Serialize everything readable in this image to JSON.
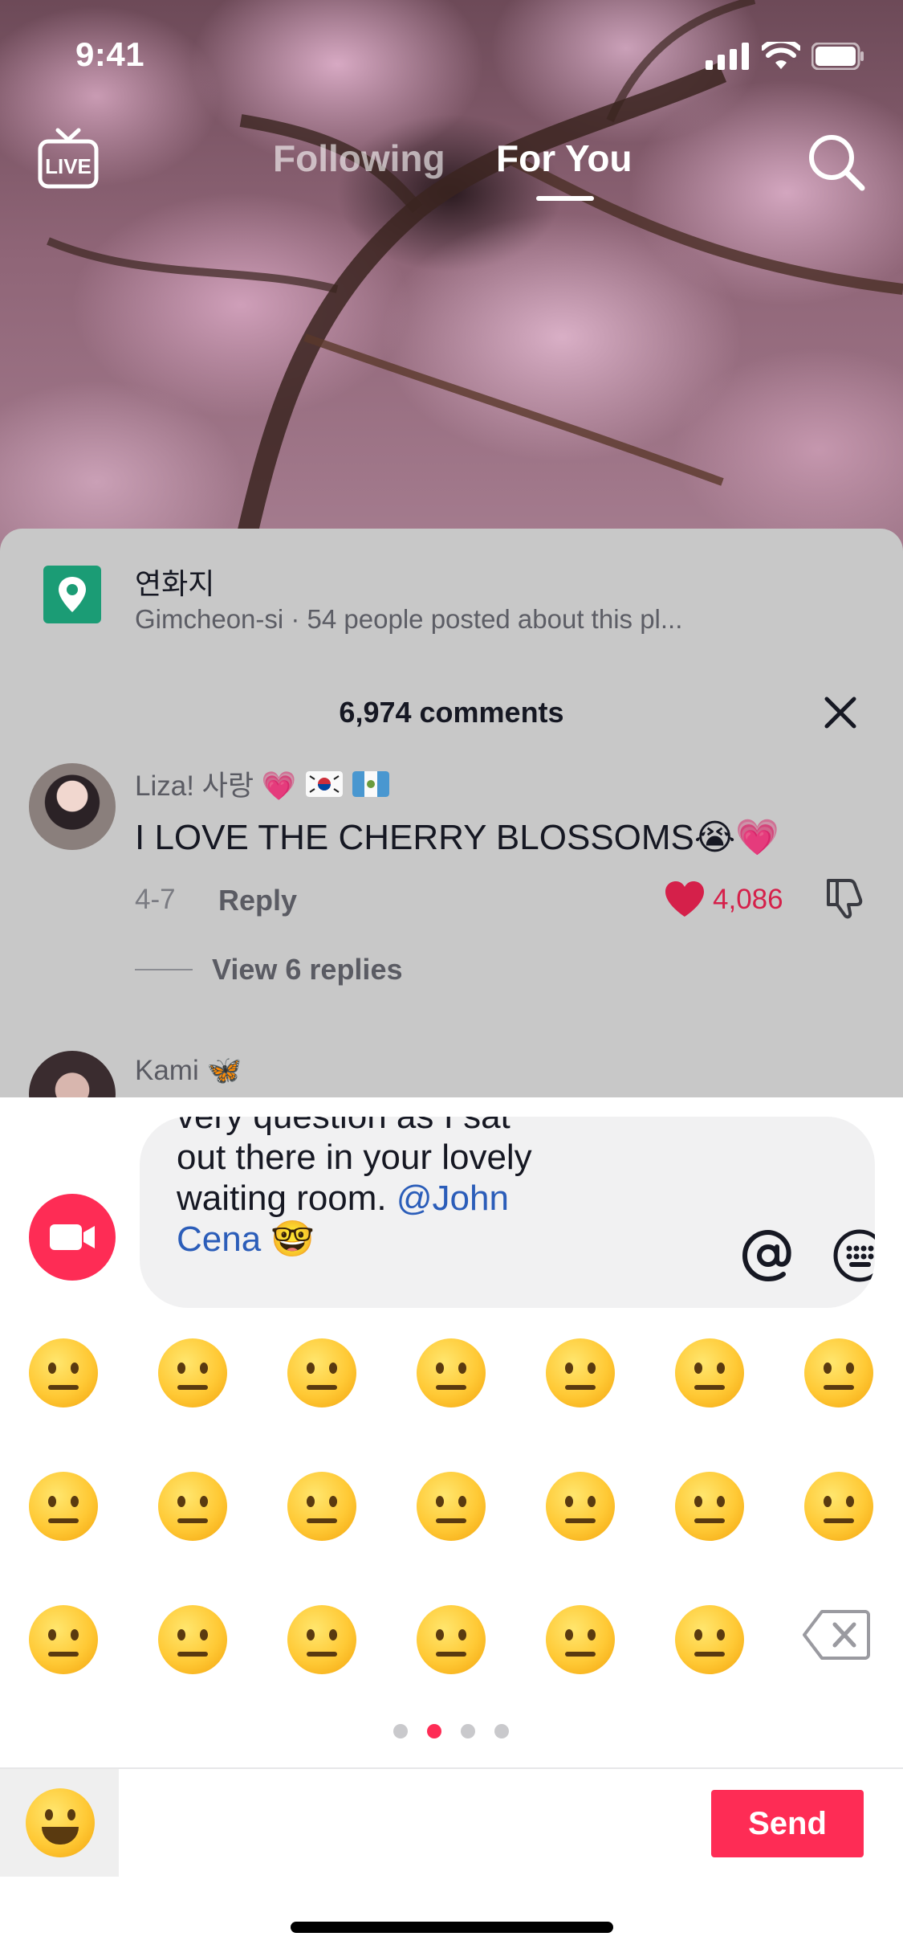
{
  "status_bar": {
    "time": "9:41"
  },
  "top_nav": {
    "live_label": "LIVE",
    "following": "Following",
    "for_you": "For You",
    "active_tab": "For You"
  },
  "location": {
    "name": "연화지",
    "subtitle": "Gimcheon-si · 54 people posted about this pl..."
  },
  "comments": {
    "count_label": "6,974 comments",
    "items": [
      {
        "user": "Liza! 사랑 💗",
        "text": "I LOVE THE CHERRY BLOSSOMS😭💗",
        "date": "4-7",
        "reply_label": "Reply",
        "likes": "4,086",
        "view_replies": "View 6 replies"
      },
      {
        "user": "Kami 🦋"
      }
    ]
  },
  "input": {
    "text_line0": "very question as I sat",
    "text_line1": "out there in your lovely",
    "text_line2_prefix": "waiting room. ",
    "mention_1": "@John",
    "mention_2": "Cena",
    "trailing_emoji": "🤓"
  },
  "emoji_keyboard": {
    "page_count": 4,
    "active_page": 1,
    "rows": [
      [
        "🤨",
        "🧐",
        "🤓",
        "😎",
        "🤩",
        "🥳",
        "😏"
      ],
      [
        "😒",
        "😞",
        "😔",
        "😟",
        "😕",
        "🙁",
        "☹️"
      ],
      [
        "😣",
        "😖",
        "😫",
        "😩",
        "🥺",
        "😢"
      ]
    ]
  },
  "bottom_bar": {
    "send_label": "Send"
  },
  "colors": {
    "accent": "#fe2c55",
    "mention": "#2b5db9",
    "location_green": "#1b9c75",
    "like_red": "#d5204a"
  }
}
